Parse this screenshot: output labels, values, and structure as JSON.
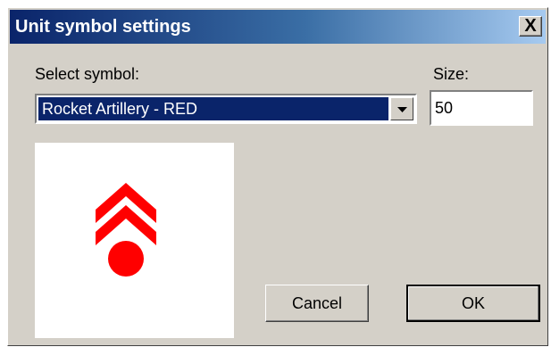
{
  "window": {
    "title": "Unit symbol settings",
    "close_label": "X"
  },
  "form": {
    "select_label": "Select symbol:",
    "selected_symbol": "Rocket Artillery - RED",
    "size_label": "Size:",
    "size_value": "50"
  },
  "preview": {
    "symbol_icon": "rocket-artillery-symbol-icon",
    "symbol_color": "#ff0000"
  },
  "buttons": {
    "cancel_label": "Cancel",
    "ok_label": "OK"
  },
  "colors": {
    "title_bar_start": "#0a246a",
    "dialog_face": "#d4d0c8",
    "selection": "#0a246a"
  }
}
